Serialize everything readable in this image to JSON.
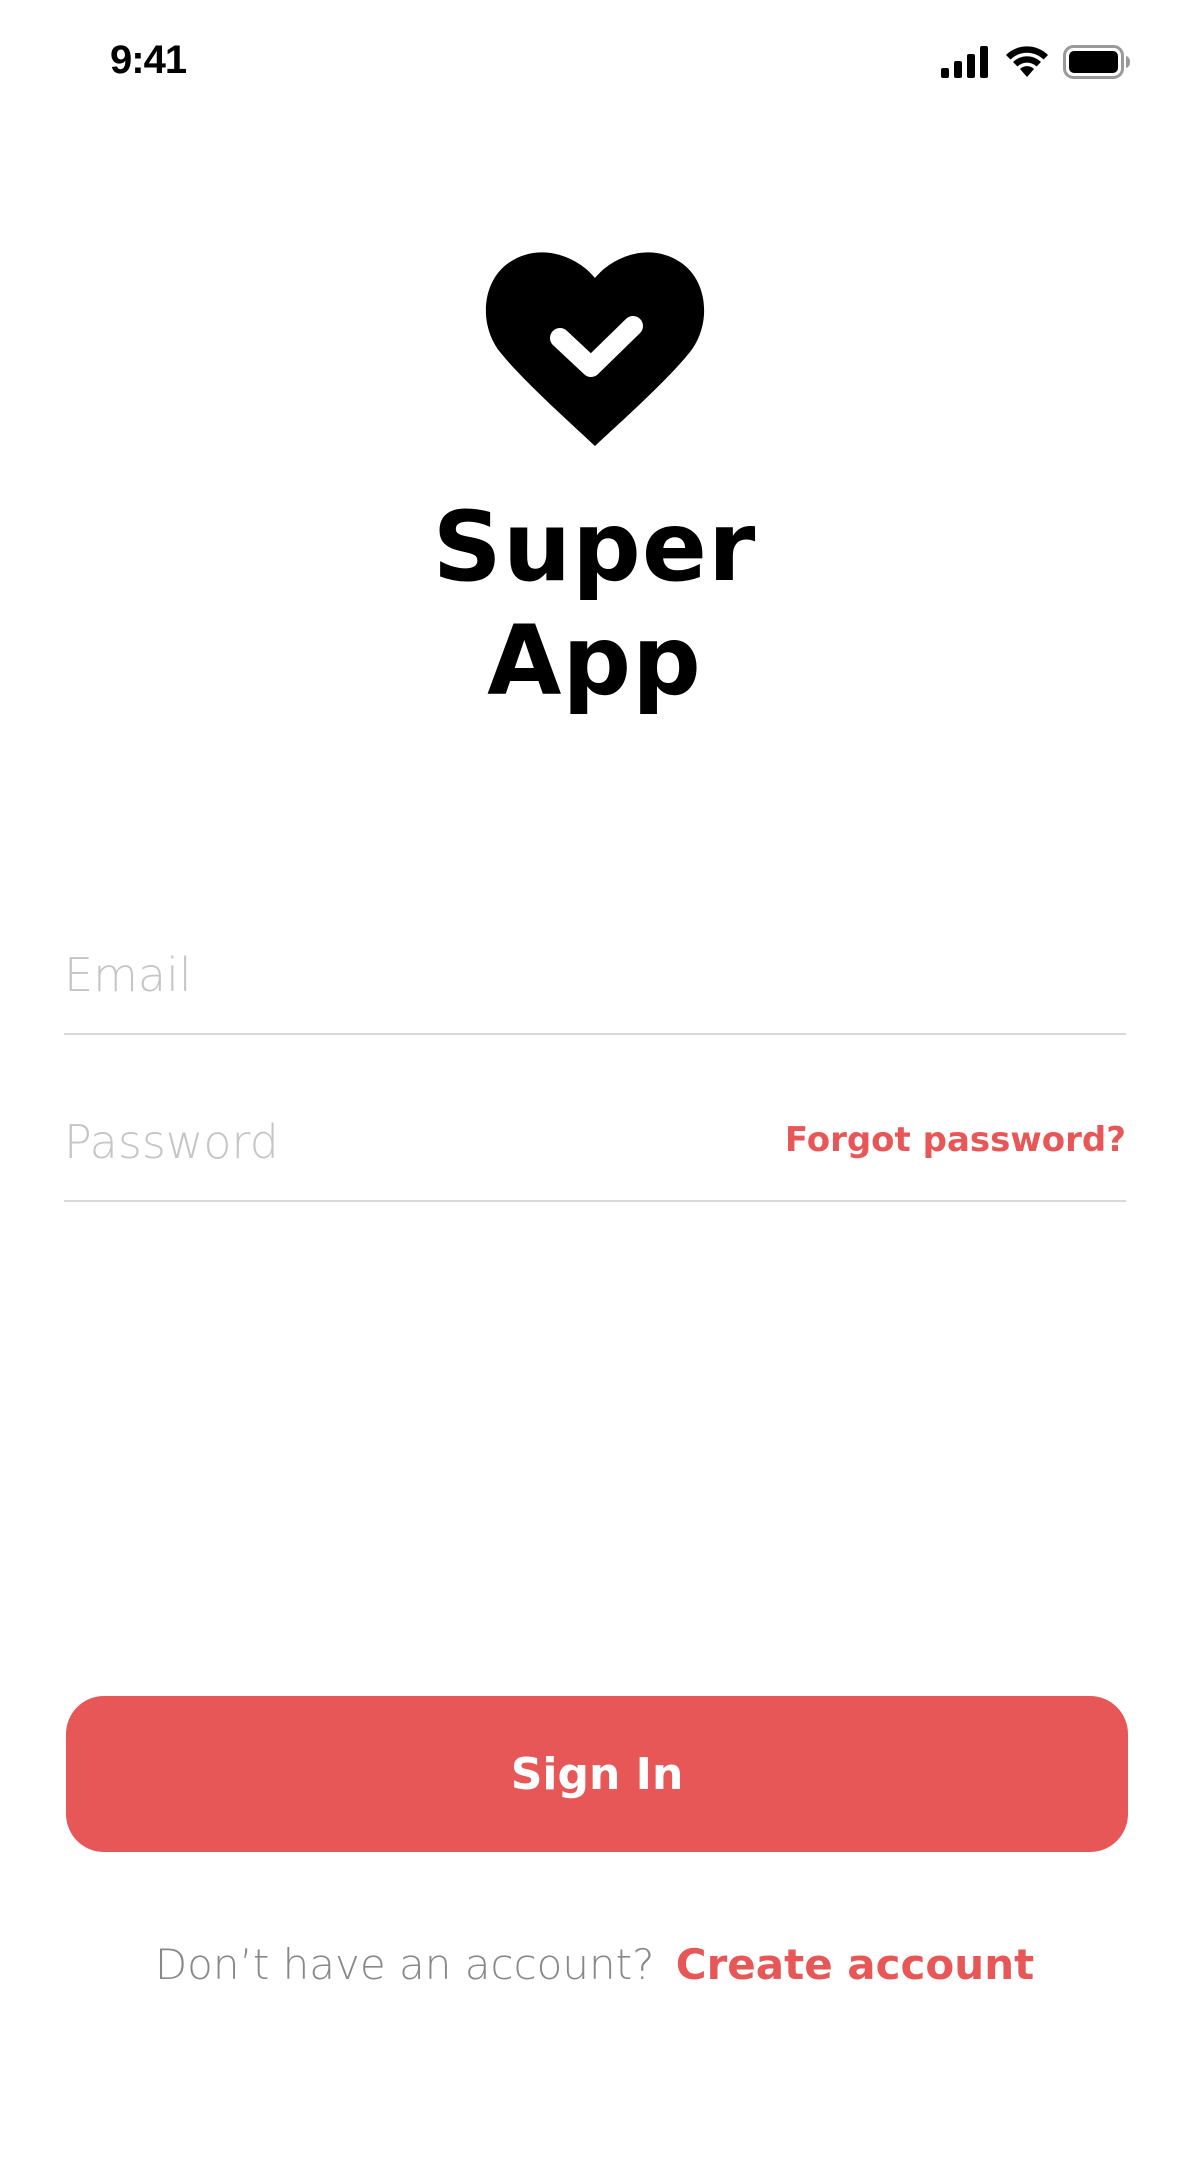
{
  "status_bar": {
    "time": "9:41",
    "icons": [
      "cellular-signal-icon",
      "wifi-icon",
      "battery-icon"
    ]
  },
  "logo": {
    "icon": "heart-check-icon",
    "title_line1": "Super",
    "title_line2": "App"
  },
  "form": {
    "email": {
      "placeholder": "Email",
      "value": ""
    },
    "password": {
      "placeholder": "Password",
      "value": ""
    },
    "forgot_label": "Forgot password?"
  },
  "actions": {
    "sign_in_label": "Sign In"
  },
  "footer": {
    "prompt": "Don’t have an account?",
    "create_label": "Create account"
  },
  "colors": {
    "accent": "#e85757",
    "placeholder": "#c5c5c5",
    "divider": "#d9d9d9",
    "muted_text": "#888888"
  }
}
